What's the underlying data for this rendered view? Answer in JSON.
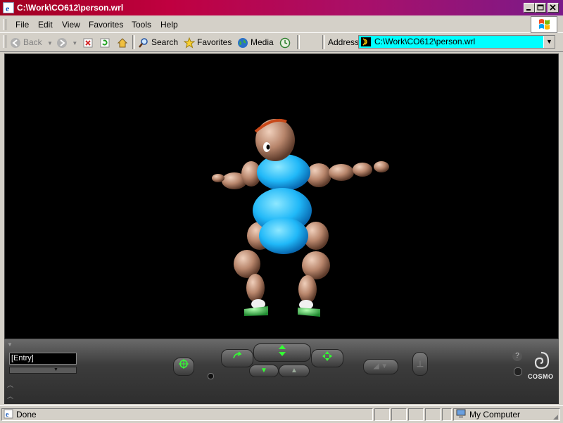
{
  "window": {
    "title": "C:\\Work\\CO612\\person.wrl"
  },
  "menu": {
    "items": [
      "File",
      "Edit",
      "View",
      "Favorites",
      "Tools",
      "Help"
    ]
  },
  "toolbar": {
    "back_label": "Back",
    "search_label": "Search",
    "favorites_label": "Favorites",
    "media_label": "Media",
    "address_label": "Address",
    "address_value": "C:\\Work\\CO612\\person.wrl"
  },
  "viewer": {
    "entry_label": "[Entry]",
    "brand": "COSMO",
    "help_glyph": "?"
  },
  "statusbar": {
    "status": "Done",
    "zone": "My Computer"
  },
  "colors": {
    "title_gradient_start": "#a00020",
    "address_bg": "#00ffff",
    "body": "#3cc8ff",
    "skin": "#c89a80"
  }
}
